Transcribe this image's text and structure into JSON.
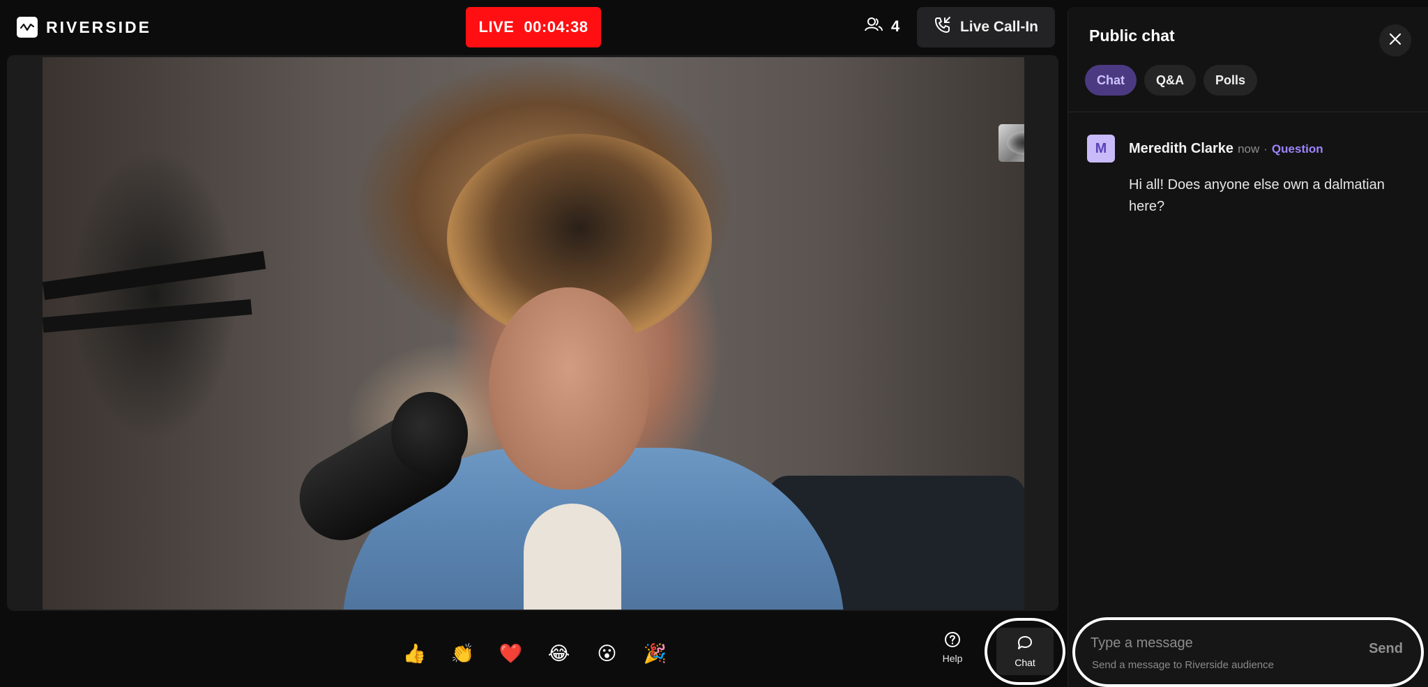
{
  "app": {
    "brand": "RIVERSIDE"
  },
  "header": {
    "live_label": "LIVE",
    "timer": "00:04:38",
    "viewer_count": "4",
    "call_in_label": "Live Call-In"
  },
  "reactions": [
    {
      "icon": "thumbs-up-icon",
      "glyph": "👍"
    },
    {
      "icon": "clapping-hands-icon",
      "glyph": "👏"
    },
    {
      "icon": "heart-icon",
      "glyph": "❤️"
    },
    {
      "icon": "laughing-face-icon",
      "glyph": "😂"
    },
    {
      "icon": "surprised-face-icon",
      "glyph": "😮"
    },
    {
      "icon": "party-popper-icon",
      "glyph": "🎉"
    }
  ],
  "toolbar": {
    "help_label": "Help",
    "chat_label": "Chat"
  },
  "chat_panel": {
    "title": "Public chat",
    "tabs": [
      {
        "label": "Chat",
        "active": true
      },
      {
        "label": "Q&A",
        "active": false
      },
      {
        "label": "Polls",
        "active": false
      }
    ],
    "messages": [
      {
        "avatar_letter": "M",
        "author": "Meredith Clarke",
        "time": "now",
        "separator": "·",
        "tag": "Question",
        "text": "Hi all! Does anyone else own a dalmatian here?"
      }
    ],
    "composer": {
      "placeholder": "Type a message",
      "hint": "Send a message to Riverside audience",
      "send_label": "Send"
    }
  },
  "colors": {
    "live": "#ff0f12",
    "accent": "#9e85ff",
    "tab_active_bg": "#4b3a82"
  }
}
